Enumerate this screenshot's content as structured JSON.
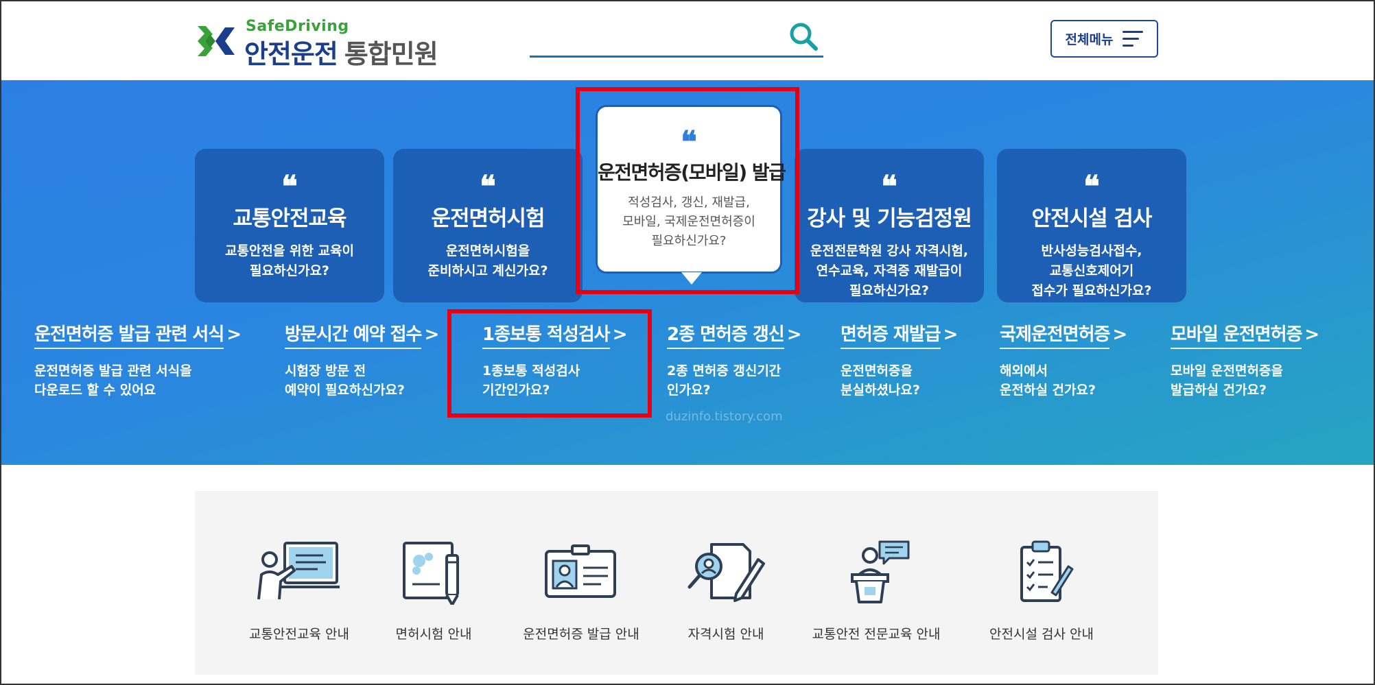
{
  "header": {
    "logo_sub": "SafeDriving",
    "logo_main": "안전운전",
    "logo_main_light": "통합민원",
    "search_placeholder": "",
    "menu_label": "전체메뉴"
  },
  "colors": {
    "brand_blue": "#1a3e8c",
    "accent_green": "#3aa23a",
    "card_blue": "#1d5fb5",
    "highlight_red": "#e60012"
  },
  "cards": [
    {
      "title": "교통안전교육",
      "desc": [
        "교통안전을 위한 교육이",
        "필요하신가요?"
      ]
    },
    {
      "title": "운전면허시험",
      "desc": [
        "운전면허시험을",
        "준비하시고 계신가요?"
      ]
    },
    {
      "title": "강사 및 기능검정원",
      "desc": [
        "운전전문학원 강사 자격시험,",
        "연수교육, 자격증 재발급이",
        "필요하신가요?"
      ]
    },
    {
      "title": "안전시설 검사",
      "desc": [
        "반사성능검사접수,",
        "교통신호제어기",
        "접수가 필요하신가요?"
      ]
    }
  ],
  "feature_card": {
    "title": "운전면허증(모바일) 발급",
    "desc": [
      "적성검사, 갱신, 재발급,",
      "모바일, 국제운전면허증이",
      "필요하신가요?"
    ]
  },
  "quick_links": [
    {
      "title": "운전면허증 발급 관련 서식",
      "desc": [
        "운전면허증 발급 관련 서식을",
        "다운로드 할 수 있어요"
      ]
    },
    {
      "title": "방문시간 예약 접수",
      "desc": [
        "시험장 방문 전",
        "예약이 필요하신가요?"
      ]
    },
    {
      "title": "1종보통 적성검사",
      "desc": [
        "1종보통 적성검사",
        "기간인가요?"
      ]
    },
    {
      "title": "2종 면허증 갱신",
      "desc": [
        "2종 면허증 갱신기간",
        "인가요?"
      ]
    },
    {
      "title": "면허증 재발급",
      "desc": [
        "운전면허증을",
        "분실하셨나요?"
      ]
    },
    {
      "title": "국제운전면허증",
      "desc": [
        "해외에서",
        "운전하실 건가요?"
      ]
    },
    {
      "title": "모바일 운전면허증",
      "desc": [
        "모바일 운전면허증을",
        "발급하실 건가요?"
      ]
    }
  ],
  "watermark": "duzinfo.tistory.com",
  "services": [
    {
      "label": "교통안전교육 안내",
      "icon": "lecture-icon"
    },
    {
      "label": "면허시험 안내",
      "icon": "exam-document-icon"
    },
    {
      "label": "운전면허증 발급 안내",
      "icon": "id-card-icon"
    },
    {
      "label": "자격시험 안내",
      "icon": "certificate-search-icon"
    },
    {
      "label": "교통안전 전문교육 안내",
      "icon": "podium-speaker-icon"
    },
    {
      "label": "안전시설 검사 안내",
      "icon": "checklist-clipboard-icon"
    }
  ]
}
